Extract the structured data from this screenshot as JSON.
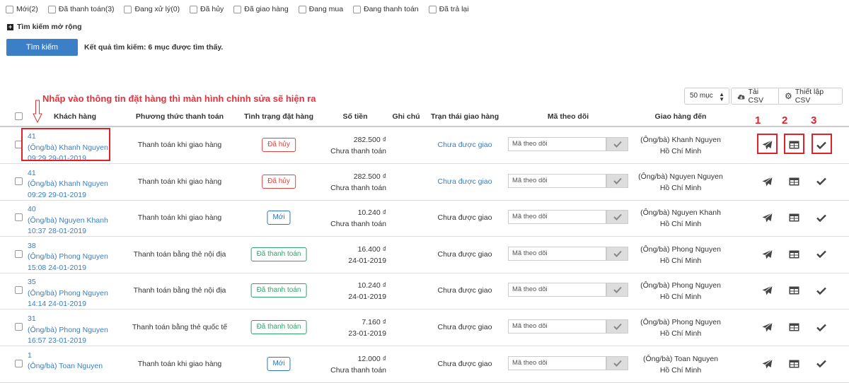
{
  "filters": [
    {
      "label": "Mới(2)"
    },
    {
      "label": "Đã thanh toán(3)"
    },
    {
      "label": "Đang xử lý(0)"
    },
    {
      "label": "Đã hủy"
    },
    {
      "label": "Đã giao hàng"
    },
    {
      "label": "Đang mua"
    },
    {
      "label": "Đang thanh toán"
    },
    {
      "label": "Đã trả lại"
    }
  ],
  "search": {
    "advanced_label": "Tìm kiếm mở rộng",
    "button_label": "Tìm kiếm",
    "result_text": "Kết quả tìm kiếm: 6 mục được tìm thấy."
  },
  "annotation": {
    "text": "Nhấp vào thông tin đặt hàng thì màn hình chỉnh sửa sẽ hiện ra",
    "num1": "1",
    "num2": "2",
    "num3": "3"
  },
  "toolbar": {
    "per_page": "50 mục",
    "csv_label": "Tải CSV",
    "settings_label": "Thiết lập CSV"
  },
  "columns": {
    "customer": "Khách hàng",
    "payment": "Phương thức thanh toán",
    "order_status": "Tình trạng đặt hàng",
    "amount": "Số tiền",
    "note": "Ghi chú",
    "ship_status": "Trạn thái giao hàng",
    "tracking": "Mã theo dõi",
    "deliver_to": "Giao hàng đến"
  },
  "colors": {
    "link": "#3a7dc0",
    "badge_red": "#e0443e",
    "badge_blue": "#2b75c0",
    "badge_green": "#2fa36b",
    "highlight": "#e0202a"
  },
  "rows": [
    {
      "id": "41",
      "name": "(Ông/bà) Khanh Nguyen",
      "time": "09:29 29-01-2019",
      "payment": "Thanh toán khi giao hàng",
      "status": "Đã hủy",
      "status_color": "red",
      "amount": "282.500 ₫",
      "amount_sub": "Chưa thanh toán",
      "ship": "Chưa được giao",
      "ship_link": true,
      "tracking_placeholder": "Mã theo dõi",
      "dest_name": "(Ông/bà) Khanh Nguyen",
      "dest_city": "Hồ Chí Minh"
    },
    {
      "id": "41",
      "name": "(Ông/bà) Khanh Nguyen",
      "time": "09:29 29-01-2019",
      "payment": "Thanh toán khi giao hàng",
      "status": "Đã hủy",
      "status_color": "red",
      "amount": "282.500 ₫",
      "amount_sub": "Chưa thanh toán",
      "ship": "Chưa được giao",
      "ship_link": true,
      "tracking_placeholder": "Mã theo dõi",
      "dest_name": "(Ông/bà) Nguyen Nguyen",
      "dest_city": "Hồ Chí Minh"
    },
    {
      "id": "40",
      "name": "(Ông/bà) Nguyen Khanh",
      "time": "10:37 28-01-2019",
      "payment": "Thanh toán khi giao hàng",
      "status": "Mới",
      "status_color": "blue",
      "amount": "10.240 ₫",
      "amount_sub": "Chưa thanh toán",
      "ship": "Chưa được giao",
      "ship_link": false,
      "tracking_placeholder": "Mã theo dõi",
      "dest_name": "(Ông/bà) Nguyen Khanh",
      "dest_city": "Hồ Chí Minh"
    },
    {
      "id": "38",
      "name": "(Ông/bà) Phong Nguyen",
      "time": "15:08 24-01-2019",
      "payment": "Thanh toán bằng thẻ nội địa",
      "status": "Đã thanh toán",
      "status_color": "green",
      "amount": "16.400 ₫",
      "amount_sub": "24-01-2019",
      "ship": "Chưa được giao",
      "ship_link": false,
      "tracking_placeholder": "Mã theo dõi",
      "dest_name": "(Ông/bà) Phong Nguyen",
      "dest_city": "Hồ Chí Minh"
    },
    {
      "id": "35",
      "name": "(Ông/bà) Phong Nguyen",
      "time": "14:14 24-01-2019",
      "payment": "Thanh toán bằng thẻ nội địa",
      "status": "Đã thanh toán",
      "status_color": "green",
      "amount": "10.240 ₫",
      "amount_sub": "24-01-2019",
      "ship": "Chưa được giao",
      "ship_link": false,
      "tracking_placeholder": "Mã theo dõi",
      "dest_name": "(Ông/bà) Phong Nguyen",
      "dest_city": "Hồ Chí Minh"
    },
    {
      "id": "31",
      "name": "(Ông/bà) Phong Nguyen",
      "time": "16:57 23-01-2019",
      "payment": "Thanh toán bằng thẻ quốc tế",
      "status": "Đã thanh toán",
      "status_color": "green",
      "amount": "7.160 ₫",
      "amount_sub": "23-01-2019",
      "ship": "Chưa được giao",
      "ship_link": false,
      "tracking_placeholder": "Mã theo dõi",
      "dest_name": "(Ông/bà) Phong Nguyen",
      "dest_city": "Hồ Chí Minh"
    },
    {
      "id": "1",
      "name": "(Ông/bà) Toan Nguyen",
      "time": "",
      "payment": "Thanh toán khi giao hàng",
      "status": "Mới",
      "status_color": "blue",
      "amount": "12.000 ₫",
      "amount_sub": "Chưa thanh toán",
      "ship": "Chưa được giao",
      "ship_link": false,
      "tracking_placeholder": "Mã theo dõi",
      "dest_name": "(Ông/bà) Toan Nguyen",
      "dest_city": "Hồ Chí Minh"
    }
  ]
}
